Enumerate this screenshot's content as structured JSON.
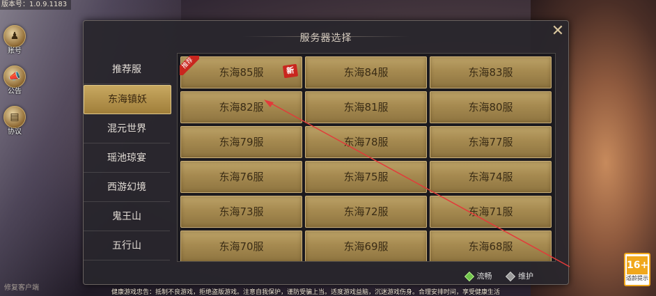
{
  "version_text": "版本号：1.0.9.1183",
  "left_buttons": [
    {
      "label": "账号",
      "icon": "account-icon"
    },
    {
      "label": "公告",
      "icon": "announcement-icon"
    },
    {
      "label": "协议",
      "icon": "agreement-icon"
    }
  ],
  "repair_client": "修复客户端",
  "dialog": {
    "title": "服务器选择",
    "close_icon": "close-icon"
  },
  "sidebar": {
    "items": [
      {
        "label": "推荐服",
        "active": false
      },
      {
        "label": "东海镇妖",
        "active": true
      },
      {
        "label": "混元世界",
        "active": false
      },
      {
        "label": "瑶池琼宴",
        "active": false
      },
      {
        "label": "西游幻境",
        "active": false
      },
      {
        "label": "鬼王山",
        "active": false
      },
      {
        "label": "五行山",
        "active": false
      }
    ]
  },
  "servers": [
    {
      "name": "东海85服",
      "ribbon": "推荐",
      "badge": "新"
    },
    {
      "name": "东海84服"
    },
    {
      "name": "东海83服"
    },
    {
      "name": "东海82服"
    },
    {
      "name": "东海81服"
    },
    {
      "name": "东海80服"
    },
    {
      "name": "东海79服"
    },
    {
      "name": "东海78服"
    },
    {
      "name": "东海77服"
    },
    {
      "name": "东海76服"
    },
    {
      "name": "东海75服"
    },
    {
      "name": "东海74服"
    },
    {
      "name": "东海73服"
    },
    {
      "name": "东海72服"
    },
    {
      "name": "东海71服"
    },
    {
      "name": "东海70服"
    },
    {
      "name": "东海69服"
    },
    {
      "name": "东海68服"
    }
  ],
  "legend": {
    "smooth": "流畅",
    "maintenance": "维护",
    "smooth_color": "#6ec24a",
    "maintenance_color": "#9a9a9a"
  },
  "health_notice": "健康游戏忠告：抵制不良游戏，拒绝盗版游戏。注意自我保护，谨防受骗上当。适度游戏益脑，沉迷游戏伤身。合理安排时间，享受健康生活",
  "age_rating": {
    "number": "16+",
    "brand": "CADPA",
    "label": "适龄提示"
  },
  "colors": {
    "accent_gold": "#a68a50",
    "ribbon_red": "#c9261e",
    "annotation_line": "#e23a3a"
  }
}
